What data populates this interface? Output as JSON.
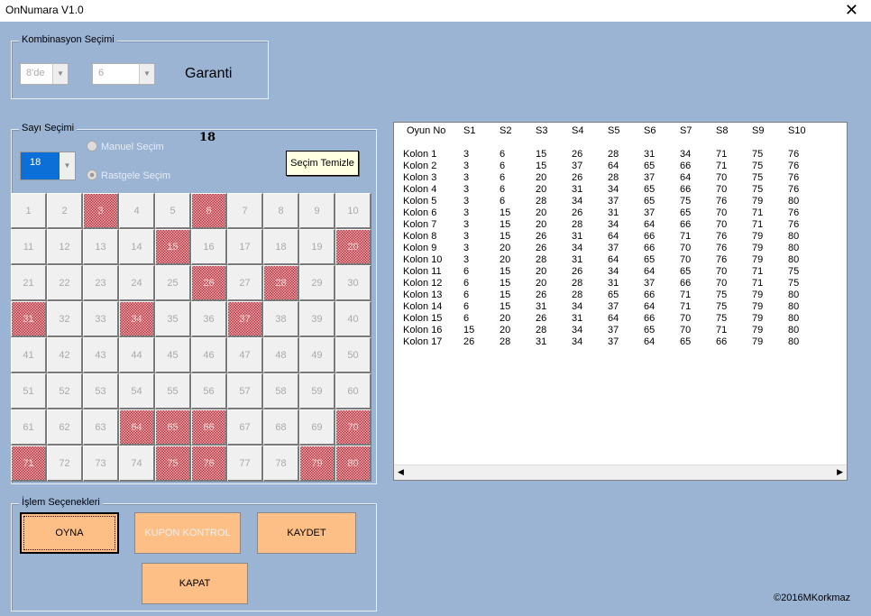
{
  "window": {
    "title": "OnNumara V1.0",
    "close_icon": "close-icon"
  },
  "kombinasyon": {
    "legend": "Kombinasyon Seçimi",
    "select1": "8'de",
    "select2": "6",
    "garanti": "Garanti"
  },
  "sayi": {
    "legend": "Sayı Seçimi",
    "count_label": "18",
    "combo_value": "18",
    "radio_manual": "Manuel Seçim",
    "radio_random": "Rastgele Seçim",
    "selected_radio": "Rastgele Seçim",
    "clear_button": "Seçim Temizle",
    "selected_numbers": [
      3,
      6,
      15,
      20,
      26,
      28,
      31,
      34,
      37,
      64,
      65,
      66,
      70,
      71,
      75,
      76,
      79,
      80
    ],
    "selected_color": "#c0303a"
  },
  "islem": {
    "legend": "İşlem Seçenekleri",
    "oyna": "OYNA",
    "kupon": "KUPON KONTROL",
    "kaydet": "KAYDET",
    "kapat": "KAPAT",
    "button_color": "#fdbf85"
  },
  "table": {
    "headers": [
      "Oyun No",
      "S1",
      "S2",
      "S3",
      "S4",
      "S5",
      "S6",
      "S7",
      "S8",
      "S9",
      "S10"
    ],
    "rows": [
      [
        "Kolon 1",
        "3",
        "6",
        "15",
        "26",
        "28",
        "31",
        "34",
        "71",
        "75",
        "76"
      ],
      [
        "Kolon 2",
        "3",
        "6",
        "15",
        "37",
        "64",
        "65",
        "66",
        "71",
        "75",
        "76"
      ],
      [
        "Kolon 3",
        "3",
        "6",
        "20",
        "26",
        "28",
        "37",
        "64",
        "70",
        "75",
        "76"
      ],
      [
        "Kolon 4",
        "3",
        "6",
        "20",
        "31",
        "34",
        "65",
        "66",
        "70",
        "75",
        "76"
      ],
      [
        "Kolon 5",
        "3",
        "6",
        "28",
        "34",
        "37",
        "65",
        "75",
        "76",
        "79",
        "80"
      ],
      [
        "Kolon 6",
        "3",
        "15",
        "20",
        "26",
        "31",
        "37",
        "65",
        "70",
        "71",
        "76"
      ],
      [
        "Kolon 7",
        "3",
        "15",
        "20",
        "28",
        "34",
        "64",
        "66",
        "70",
        "71",
        "76"
      ],
      [
        "Kolon 8",
        "3",
        "15",
        "26",
        "31",
        "64",
        "66",
        "71",
        "76",
        "79",
        "80"
      ],
      [
        "Kolon 9",
        "3",
        "20",
        "26",
        "34",
        "37",
        "66",
        "70",
        "76",
        "79",
        "80"
      ],
      [
        "Kolon 10",
        "3",
        "20",
        "28",
        "31",
        "64",
        "65",
        "70",
        "76",
        "79",
        "80"
      ],
      [
        "Kolon 11",
        "6",
        "15",
        "20",
        "26",
        "34",
        "64",
        "65",
        "70",
        "71",
        "75"
      ],
      [
        "Kolon 12",
        "6",
        "15",
        "20",
        "28",
        "31",
        "37",
        "66",
        "70",
        "71",
        "75"
      ],
      [
        "Kolon 13",
        "6",
        "15",
        "26",
        "28",
        "65",
        "66",
        "71",
        "75",
        "79",
        "80"
      ],
      [
        "Kolon 14",
        "6",
        "15",
        "31",
        "34",
        "37",
        "64",
        "71",
        "75",
        "79",
        "80"
      ],
      [
        "Kolon 15",
        "6",
        "20",
        "26",
        "31",
        "64",
        "66",
        "70",
        "75",
        "79",
        "80"
      ],
      [
        "Kolon 16",
        "15",
        "20",
        "28",
        "34",
        "37",
        "65",
        "70",
        "71",
        "79",
        "80"
      ],
      [
        "Kolon 17",
        "26",
        "28",
        "31",
        "34",
        "37",
        "64",
        "65",
        "66",
        "79",
        "80"
      ]
    ]
  },
  "footer": {
    "copyright": "©2016MKorkmaz"
  }
}
